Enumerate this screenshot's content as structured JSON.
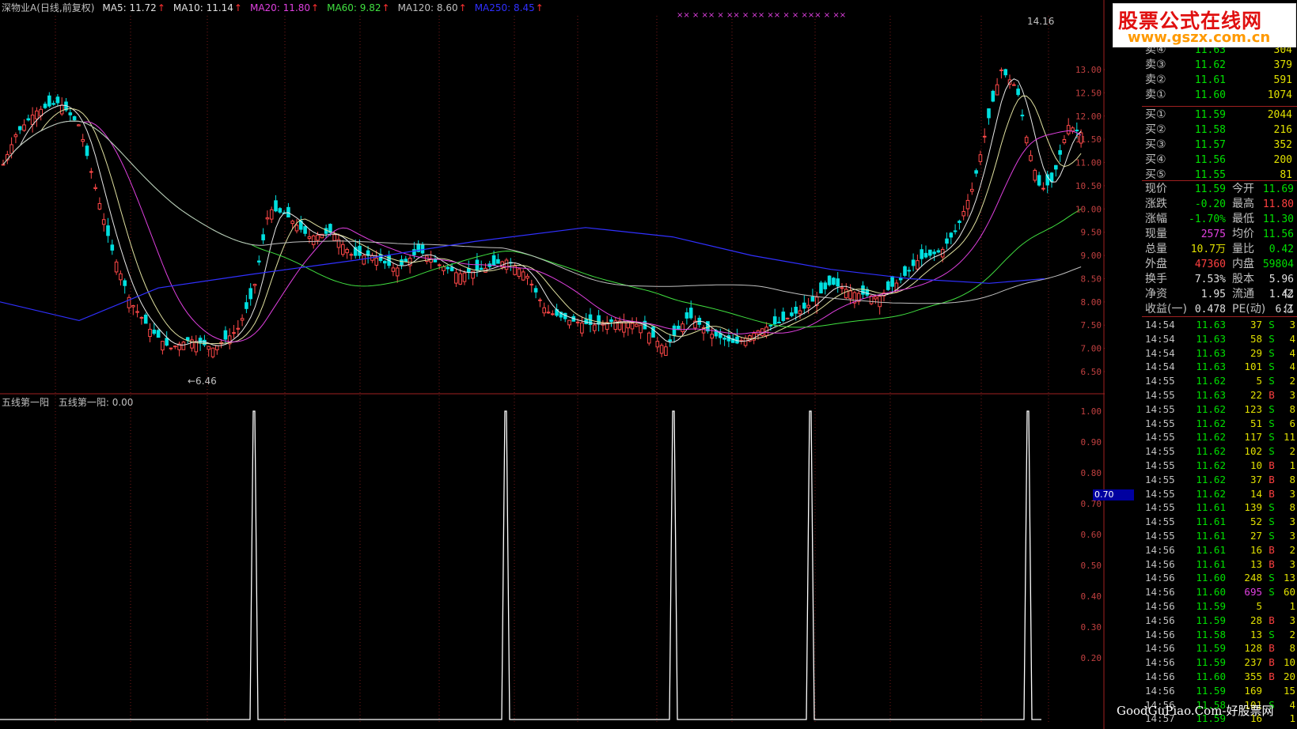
{
  "header": {
    "stock_title": "深物业A(日线,前复权)",
    "ma": [
      {
        "label": "MA5: 11.72",
        "color": "#e0e0e0"
      },
      {
        "label": "MA10: 11.14",
        "color": "#e0e0e0"
      },
      {
        "label": "MA20: 11.80",
        "color": "#e040e0"
      },
      {
        "label": "MA60: 9.82",
        "color": "#40e040"
      },
      {
        "label": "MA120: 8.60",
        "color": "#c0c0c0"
      },
      {
        "label": "MA250: 8.45",
        "color": "#3030ff"
      }
    ],
    "arrow": "↑"
  },
  "main_chart": {
    "high_label": "14.16",
    "low_label": "←6.46",
    "y_ticks": [
      "13.00",
      "12.50",
      "12.00",
      "11.50",
      "11.00",
      "10.50",
      "10.00",
      "9.50",
      "9.00",
      "8.50",
      "8.00",
      "7.50",
      "7.00",
      "6.50"
    ],
    "top_marks": "××  ×  ××  ×         ××  × ××  ××  ×   ×    ×××  ×        ××"
  },
  "sub_chart": {
    "title": "五线第一阳",
    "value_label": "五线第一阳: 0.00",
    "y_ticks": [
      "1.00",
      "0.90",
      "0.80",
      "0.70",
      "0.60",
      "0.50",
      "0.40",
      "0.30",
      "0.20"
    ],
    "cursor_value": "0.70"
  },
  "order_book": {
    "asks": [
      {
        "label": "卖④",
        "price": "11.63",
        "vol": "304"
      },
      {
        "label": "卖③",
        "price": "11.62",
        "vol": "379"
      },
      {
        "label": "卖②",
        "price": "11.61",
        "vol": "591"
      },
      {
        "label": "卖①",
        "price": "11.60",
        "vol": "1074"
      }
    ],
    "bids": [
      {
        "label": "买①",
        "price": "11.59",
        "vol": "2044"
      },
      {
        "label": "买②",
        "price": "11.58",
        "vol": "216"
      },
      {
        "label": "买③",
        "price": "11.57",
        "vol": "352"
      },
      {
        "label": "买④",
        "price": "11.56",
        "vol": "200"
      },
      {
        "label": "买⑤",
        "price": "11.55",
        "vol": "81"
      }
    ]
  },
  "quote": [
    {
      "l1": "现价",
      "v1": "11.59",
      "c1": "#00e000",
      "l2": "今开",
      "v2": "11.69",
      "c2": "#00e000"
    },
    {
      "l1": "涨跌",
      "v1": "-0.20",
      "c1": "#00e000",
      "l2": "最高",
      "v2": "11.80",
      "c2": "#ff4040"
    },
    {
      "l1": "涨幅",
      "v1": "-1.70%",
      "c1": "#00e000",
      "l2": "最低",
      "v2": "11.30",
      "c2": "#00e000"
    },
    {
      "l1": "现量",
      "v1": "2575",
      "c1": "#e040e0",
      "l2": "均价",
      "v2": "11.56",
      "c2": "#00e000"
    },
    {
      "l1": "总量",
      "v1": "10.7万",
      "c1": "#e0e000",
      "l2": "量比",
      "v2": "0.42",
      "c2": "#00e000"
    },
    {
      "l1": "外盘",
      "v1": "47360",
      "c1": "#ff4040",
      "l2": "内盘",
      "v2": "59804",
      "c2": "#00e000"
    },
    {
      "l1": "换手",
      "v1": "7.53%",
      "c1": "#e0e0e0",
      "l2": "股本",
      "v2": "5.96亿",
      "c2": "#e0e0e0"
    },
    {
      "l1": "净资",
      "v1": "1.95",
      "c1": "#e0e0e0",
      "l2": "流通",
      "v2": "1.42亿",
      "c2": "#e0e0e0"
    },
    {
      "l1": "收益(一)",
      "v1": "0.478",
      "c1": "#e0e0e0",
      "l2": "PE(动)",
      "v2": "6.1",
      "c2": "#e0e0e0"
    }
  ],
  "trades": [
    {
      "t": "14:54",
      "p": "11.63",
      "q": "37",
      "s": "S",
      "n": "3"
    },
    {
      "t": "14:54",
      "p": "11.63",
      "q": "58",
      "s": "S",
      "n": "4"
    },
    {
      "t": "14:54",
      "p": "11.63",
      "q": "29",
      "s": "S",
      "n": "4"
    },
    {
      "t": "14:54",
      "p": "11.63",
      "q": "101",
      "s": "S",
      "n": "4"
    },
    {
      "t": "14:55",
      "p": "11.62",
      "q": "5",
      "s": "S",
      "n": "2"
    },
    {
      "t": "14:55",
      "p": "11.63",
      "q": "22",
      "s": "B",
      "n": "3"
    },
    {
      "t": "14:55",
      "p": "11.62",
      "q": "123",
      "s": "S",
      "n": "8"
    },
    {
      "t": "14:55",
      "p": "11.62",
      "q": "51",
      "s": "S",
      "n": "6"
    },
    {
      "t": "14:55",
      "p": "11.62",
      "q": "117",
      "s": "S",
      "n": "11"
    },
    {
      "t": "14:55",
      "p": "11.62",
      "q": "102",
      "s": "S",
      "n": "2"
    },
    {
      "t": "14:55",
      "p": "11.62",
      "q": "10",
      "s": "B",
      "n": "1"
    },
    {
      "t": "14:55",
      "p": "11.62",
      "q": "37",
      "s": "B",
      "n": "8"
    },
    {
      "t": "14:55",
      "p": "11.62",
      "q": "14",
      "s": "B",
      "n": "3"
    },
    {
      "t": "14:55",
      "p": "11.61",
      "q": "139",
      "s": "S",
      "n": "8"
    },
    {
      "t": "14:55",
      "p": "11.61",
      "q": "52",
      "s": "S",
      "n": "3"
    },
    {
      "t": "14:55",
      "p": "11.61",
      "q": "27",
      "s": "S",
      "n": "3"
    },
    {
      "t": "14:56",
      "p": "11.61",
      "q": "16",
      "s": "B",
      "n": "2"
    },
    {
      "t": "14:56",
      "p": "11.61",
      "q": "13",
      "s": "B",
      "n": "3"
    },
    {
      "t": "14:56",
      "p": "11.60",
      "q": "248",
      "s": "S",
      "n": "13"
    },
    {
      "t": "14:56",
      "p": "11.60",
      "q": "695",
      "s": "S",
      "n": "60"
    },
    {
      "t": "14:56",
      "p": "11.59",
      "q": "5",
      "s": "",
      "n": "1"
    },
    {
      "t": "14:56",
      "p": "11.59",
      "q": "28",
      "s": "B",
      "n": "3"
    },
    {
      "t": "14:56",
      "p": "11.58",
      "q": "13",
      "s": "S",
      "n": "2"
    },
    {
      "t": "14:56",
      "p": "11.59",
      "q": "128",
      "s": "B",
      "n": "8"
    },
    {
      "t": "14:56",
      "p": "11.59",
      "q": "237",
      "s": "B",
      "n": "10"
    },
    {
      "t": "14:56",
      "p": "11.60",
      "q": "355",
      "s": "B",
      "n": "20"
    },
    {
      "t": "14:56",
      "p": "11.59",
      "q": "169",
      "s": "",
      "n": "15"
    },
    {
      "t": "14:56",
      "p": "11.58",
      "q": "101",
      "s": "S",
      "n": "4"
    },
    {
      "t": "14:57",
      "p": "11.59",
      "q": "16",
      "s": "",
      "n": "1"
    }
  ],
  "watermark": {
    "title": "股票公式在线网",
    "url": "www.gszx.com.cn"
  },
  "footer_mark": "GoodGuPiao.Com-好股票网"
}
